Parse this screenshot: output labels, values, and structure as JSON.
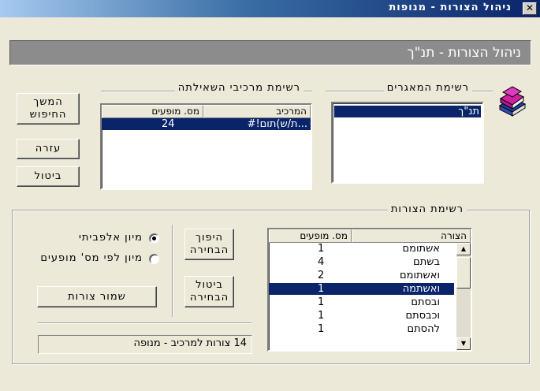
{
  "window": {
    "title": "ניהול הצורות - מנופות",
    "close_label": "✕"
  },
  "header": {
    "text": "ניהול הצורות - תנ\"ך"
  },
  "databases": {
    "legend": "רשימת המאגרים",
    "items": [
      "תנ\"ך"
    ]
  },
  "components": {
    "legend": "רשימת מרכיבי השאילתה",
    "col_component": "המרכיב",
    "col_count": "מס. מופעים",
    "rows": [
      {
        "component": "#!ת/ש)תום...",
        "count": "24"
      }
    ]
  },
  "buttons": {
    "continue_line1": "המשך",
    "continue_line2": "החיפוש",
    "help": "עזרה",
    "cancel": "ביטול"
  },
  "forms": {
    "legend": "רשימת הצורות",
    "col_form": "הצורה",
    "col_count": "מס. מופעים",
    "rows": [
      {
        "form": "אשתומם",
        "count": "1"
      },
      {
        "form": "בשתם",
        "count": "4"
      },
      {
        "form": "ואשתומם",
        "count": "2"
      },
      {
        "form": "ואשתמה",
        "count": "1"
      },
      {
        "form": "ובסתם",
        "count": "1"
      },
      {
        "form": "וכבסתם",
        "count": "1"
      },
      {
        "form": "להסתם",
        "count": "1"
      }
    ],
    "selected_index": 3
  },
  "selection": {
    "invert_line1": "היפוך",
    "invert_line2": "הבחירה",
    "cancel_line1": "ביטול",
    "cancel_line2": "הבחירה"
  },
  "sort": {
    "alpha_label": "מיון אלפביתי",
    "count_label": "מיון לפי מס' מופעים",
    "alpha_checked": true
  },
  "save_forms": "שמור צורות",
  "status_text": "14 צורות למרכיב - מנופה"
}
